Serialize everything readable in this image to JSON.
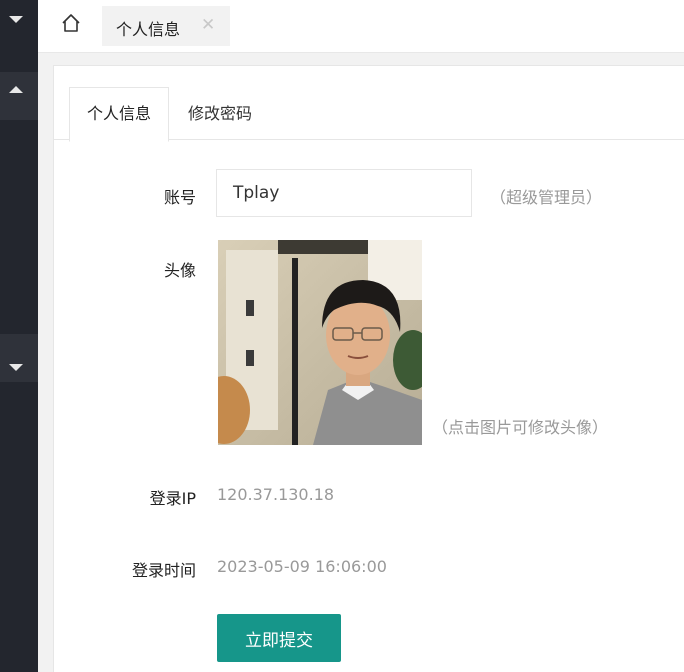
{
  "topbar": {
    "home_icon": "home-icon",
    "tab_label": "个人信息",
    "tab_close": "✕"
  },
  "card": {
    "tabs": [
      {
        "label": "个人信息",
        "active": true
      },
      {
        "label": "修改密码",
        "active": false
      }
    ]
  },
  "form": {
    "account_label": "账号",
    "account_value": "Tplay",
    "role_hint": "（超级管理员）",
    "avatar_label": "头像",
    "avatar_hint": "（点击图片可修改头像）",
    "ip_label": "登录IP",
    "ip_value": "120.37.130.18",
    "time_label": "登录时间",
    "time_value": "2023-05-09 16:06:00",
    "submit_label": "立即提交"
  },
  "colors": {
    "sidebar": "#23262e",
    "submit": "#16968a",
    "hint": "#999999"
  }
}
